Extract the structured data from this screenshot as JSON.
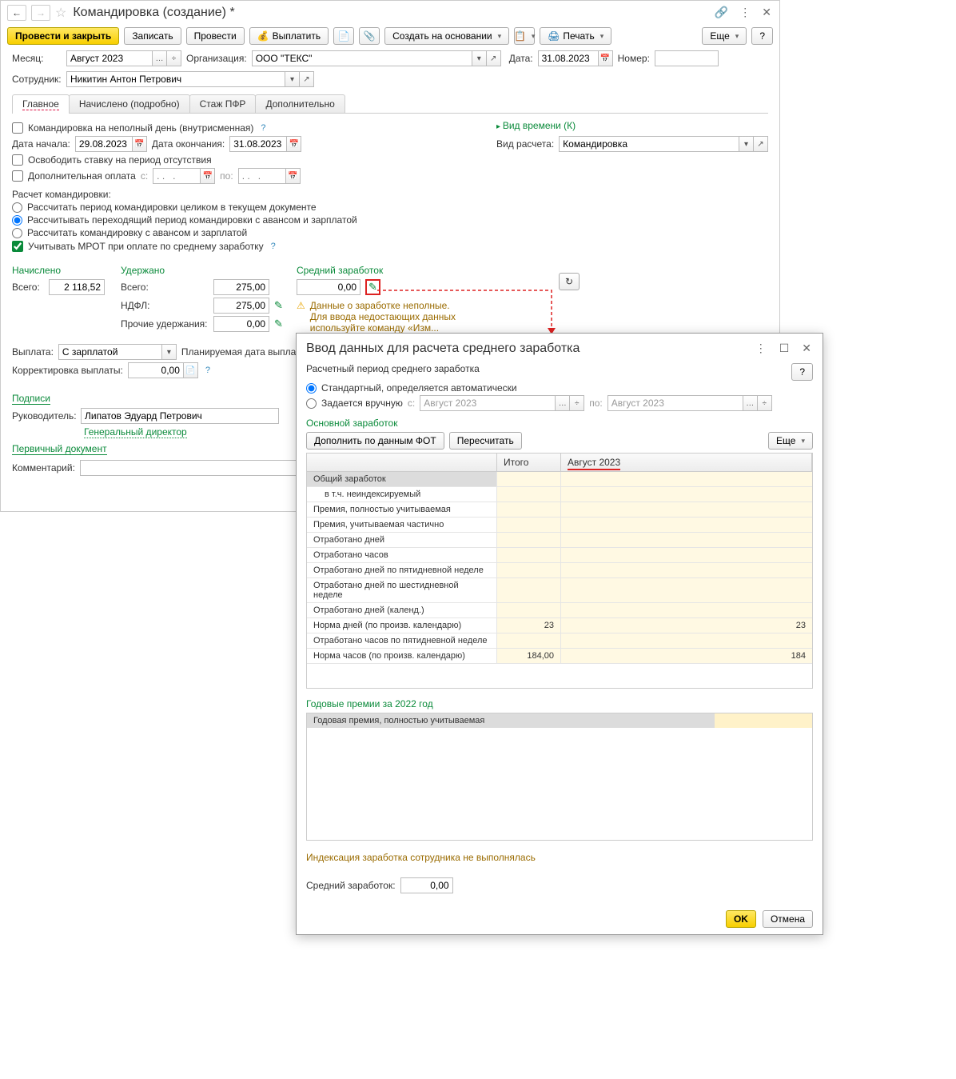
{
  "header": {
    "title": "Командировка (создание) *"
  },
  "toolbar": {
    "post_close": "Провести и закрыть",
    "save": "Записать",
    "post": "Провести",
    "pay": "Выплатить",
    "create_basis": "Создать на основании",
    "print": "Печать",
    "more": "Еще",
    "help": "?"
  },
  "fields": {
    "month_lbl": "Месяц:",
    "month_val": "Август 2023",
    "org_lbl": "Организация:",
    "org_val": "ООО \"ТЕКС\"",
    "date_lbl": "Дата:",
    "date_val": "31.08.2023",
    "num_lbl": "Номер:",
    "emp_lbl": "Сотрудник:",
    "emp_val": "Никитин Антон Петрович"
  },
  "tabs": {
    "main": "Главное",
    "accrued": "Начислено (подробно)",
    "pfr": "Стаж ПФР",
    "extra": "Дополнительно"
  },
  "main": {
    "partial_day": "Командировка на неполный день (внутрисменная)",
    "start_lbl": "Дата начала:",
    "start_val": "29.08.2023",
    "end_lbl": "Дата окончания:",
    "end_val": "31.08.2023",
    "release_rate": "Освободить ставку на период отсутствия",
    "extra_pay": "Дополнительная оплата",
    "from_lbl": "с:",
    "from_ph": ". .   .",
    "to_lbl": "по:",
    "to_ph": ". .   .",
    "calc_hdr": "Расчет командировки:",
    "r1": "Рассчитать период командировки целиком в текущем документе",
    "r2": "Рассчитывать переходящий период командировки с авансом и зарплатой",
    "r3": "Рассчитать командировку с авансом и зарплатой",
    "consider_mrot": "Учитывать МРОТ при оплате по среднему заработку",
    "accrued_hdr": "Начислено",
    "withheld_hdr": "Удержано",
    "avg_hdr": "Средний заработок",
    "total_lbl": "Всего:",
    "total_val": "2 118,52",
    "withheld_total": "275,00",
    "avg_val": "0,00",
    "ndfl_lbl": "НДФЛ:",
    "ndfl_val": "275,00",
    "other_lbl": "Прочие удержания:",
    "other_val": "0,00",
    "warn1": "Данные о заработке неполные.",
    "warn2": "Для ввода недостающих данных используйте команду «Изм...",
    "payout_lbl": "Выплата:",
    "payout_val": "С зарплатой",
    "plan_date_lbl": "Планируемая дата выпла",
    "corr_lbl": "Корректировка выплаты:",
    "corr_val": "0,00",
    "time_type": "Вид времени (К)",
    "calc_type_lbl": "Вид расчета:",
    "calc_type_val": "Командировка",
    "signs": "Подписи",
    "manager_lbl": "Руководитель:",
    "manager_val": "Липатов Эдуард Петрович",
    "gendir": "Генеральный директор",
    "primary_doc": "Первичный документ",
    "comment_lbl": "Комментарий:"
  },
  "dialog": {
    "title": "Ввод данных для расчета среднего заработка",
    "help": "?",
    "period_lbl": "Расчетный период среднего заработка",
    "r_auto": "Стандартный, определяется автоматически",
    "r_manual": "Задается вручную",
    "from_lbl": "с:",
    "period_val": "Август 2023",
    "to_lbl": "по:",
    "section_main": "Основной заработок",
    "fill_fot": "Дополнить по данным ФОТ",
    "recalc": "Пересчитать",
    "more": "Еще",
    "th_total": "Итого",
    "th_month": "Август 2023",
    "rows": [
      {
        "label": "Общий заработок",
        "sel": true
      },
      {
        "label": "в т.ч. неиндексируемый",
        "indent": true
      },
      {
        "label": "Премия, полностью учитываемая"
      },
      {
        "label": "Премия, учитываемая частично"
      },
      {
        "label": "Отработано дней"
      },
      {
        "label": "Отработано часов"
      },
      {
        "label": "Отработано дней по пятидневной неделе"
      },
      {
        "label": "Отработано дней по шестидневной неделе"
      },
      {
        "label": "Отработано дней (календ.)"
      },
      {
        "label": "Норма дней (по произв. календарю)",
        "total": "23",
        "month": "23"
      },
      {
        "label": "Отработано часов по пятидневной неделе"
      },
      {
        "label": "Норма часов (по произв. календарю)",
        "total": "184,00",
        "month": "184"
      }
    ],
    "year_section": "Годовые премии за 2022 год",
    "year_row": "Годовая премия, полностью учитываемая",
    "index_note": "Индексация заработка сотрудника не выполнялась",
    "avg_lbl": "Средний заработок:",
    "avg_val": "0,00",
    "ok": "OK",
    "cancel": "Отмена"
  }
}
